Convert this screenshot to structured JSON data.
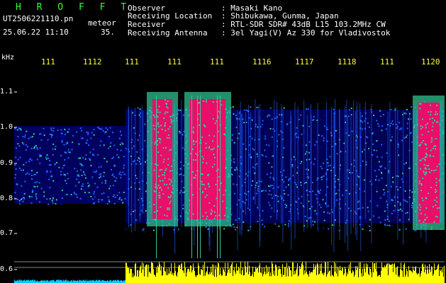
{
  "header": {
    "title": "H R O F F T",
    "filename": "UT2506221110.pn",
    "meteor_label": "meteor",
    "date_time": "25.06.22 11:10",
    "count": "35."
  },
  "info": [
    {
      "label": "Observer",
      "value": ": Masaki Kano"
    },
    {
      "label": "Receiving Location",
      "value": ": Shibukawa, Gunma, Japan"
    },
    {
      "label": "Receiver",
      "value": ": RTL-SDR SDR# 43dB L15 103.2MHz CW"
    },
    {
      "label": "Receiving Antenna",
      "value": ": 3el Yagi(V) Az 330 for Vladivostok"
    }
  ],
  "axis": {
    "unit": "kHz",
    "y_ticks": [
      "1.1",
      "1.0",
      "0.9",
      "0.8",
      "0.7",
      "0.6"
    ],
    "minute_labels": [
      "111",
      "1112",
      "111",
      "111",
      "111",
      "1116",
      "1117",
      "1118",
      "111",
      "1120"
    ]
  },
  "colors": {
    "header_title": "#33ff33",
    "text": "#ffffff",
    "info_values": "#ffffff",
    "minute_labels": "#ffff33",
    "tick": "#ffffff",
    "noise_low": "#0000aa",
    "noise_mid": "#2266ff",
    "echo_mid": "#33cc99",
    "echo_high": "#ff0066",
    "spectrum_yellow": "#ffff00",
    "spectrum_cyan": "#00ccff"
  }
}
